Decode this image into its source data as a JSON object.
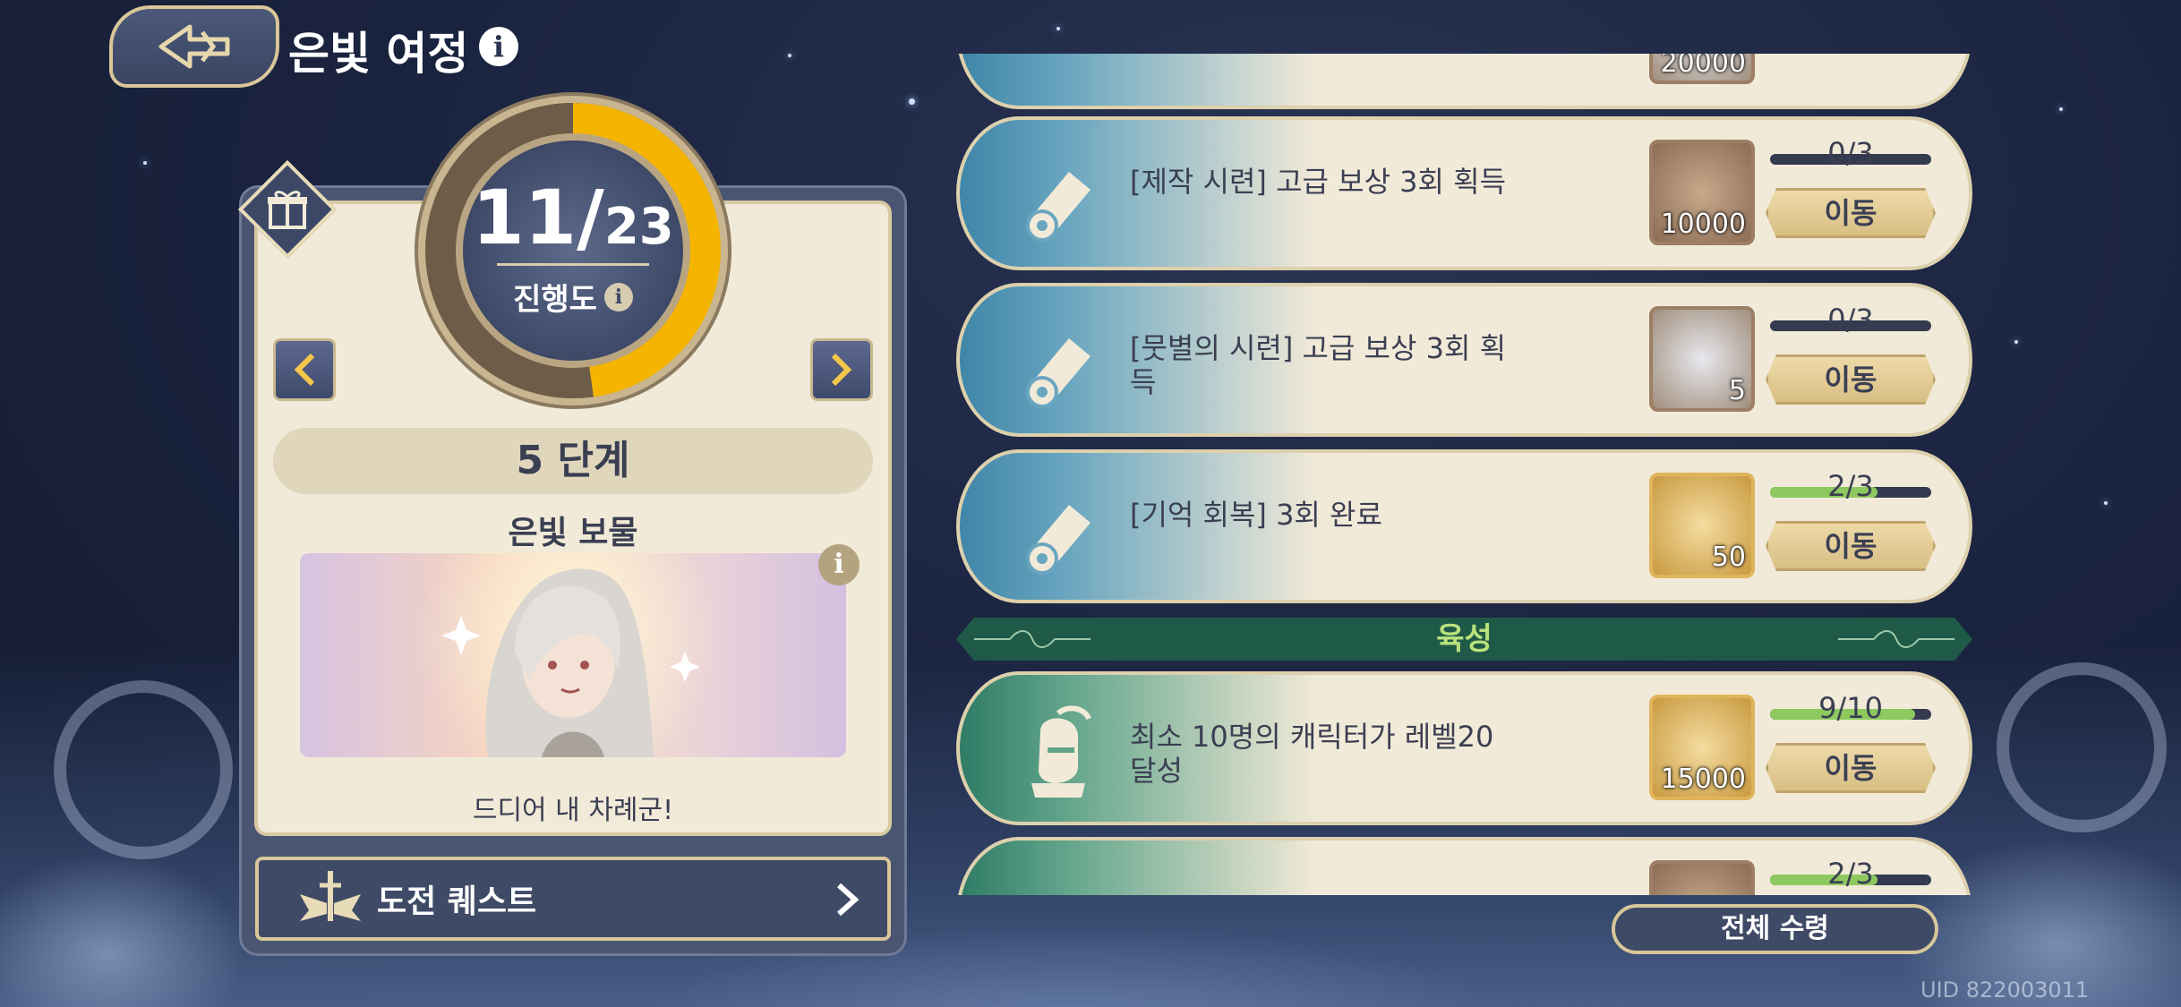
{
  "header": {
    "title": "은빛 여정",
    "info_icon": "i"
  },
  "progress": {
    "current": "11",
    "total": "23",
    "label": "진행도",
    "info_icon": "i",
    "fraction": 0.478
  },
  "stage": {
    "label": "5 단계"
  },
  "reward": {
    "name": "은빛 보물",
    "caption": "드디어 내 차례군!",
    "info_icon": "i"
  },
  "challenge": {
    "label": "도전 퀘스트"
  },
  "quests": [
    {
      "text": "[제작 시련] 고급 보상 3회 획득",
      "reward_count": "10000",
      "reward_icon": "crystal-pile-icon",
      "progress_text": "0/3",
      "progress": 0.0,
      "button": "이동"
    },
    {
      "text": "[뭇별의 시련] 고급 보상 3회 획득",
      "reward_count": "5",
      "reward_icon": "silver-orb-icon",
      "progress_text": "0/3",
      "progress": 0.0,
      "button": "이동"
    },
    {
      "text": "[기억 회복] 3회 완료",
      "reward_count": "50",
      "reward_icon": "character-portrait-icon",
      "progress_text": "2/3",
      "progress": 0.667,
      "button": "이동"
    }
  ],
  "section": {
    "title": "육성"
  },
  "growth_quests": [
    {
      "text": "최소 10명의 캐릭터가 레벨20 달성",
      "reward_count": "15000",
      "reward_icon": "gold-coin-icon",
      "progress_text": "9/10",
      "progress": 0.9,
      "button": "이동"
    }
  ],
  "partial_top": {
    "reward_count": "20000"
  },
  "partial_bottom": {
    "progress_text": "2/3",
    "progress": 0.667
  },
  "claim_all": {
    "label": "전체 수령"
  },
  "uid": {
    "text": "UID 822003011"
  },
  "colors": {
    "accent_gold": "#f4b400",
    "progress_green": "#8dc95f",
    "section_green": "#1f5a48",
    "panel_navy": "#3f4a66"
  }
}
